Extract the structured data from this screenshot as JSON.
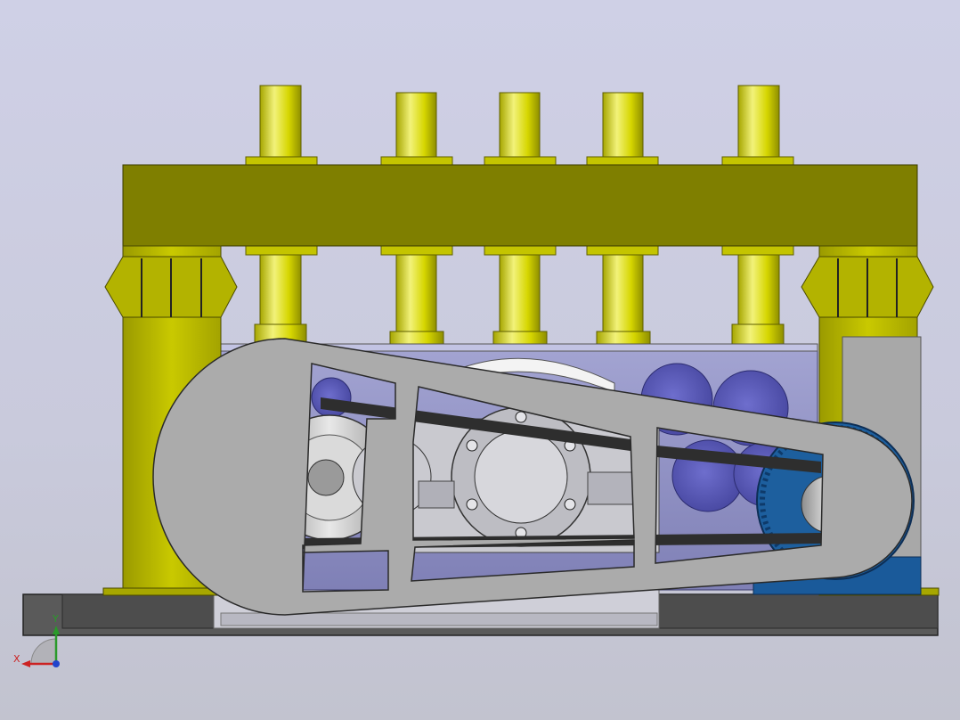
{
  "viewport": {
    "background_top": "#cfd0e6",
    "background_bottom": "#c2c3cf"
  },
  "model": {
    "name": "",
    "colors": {
      "frame_yellow": "#7f7f00",
      "frame_yellow_light": "#b8b800",
      "cylinder_yellow": "#d6d600",
      "cylinder_highlight": "#f2f27a",
      "guard_gray": "#a9a9a9",
      "guard_edge": "#2a2a2a",
      "body_lavender": "#8e8fc2",
      "blue_disc": "#5a5ab8",
      "motor_blue": "#1a5a9a",
      "base_dark": "#555555",
      "belt_black": "#2e2e2e"
    },
    "cylinders": 5
  },
  "triad": {
    "y_label": "Y",
    "x_label": "X",
    "y_color": "#2a9a2a",
    "x_color": "#cc2222",
    "z_color": "#2244cc"
  }
}
